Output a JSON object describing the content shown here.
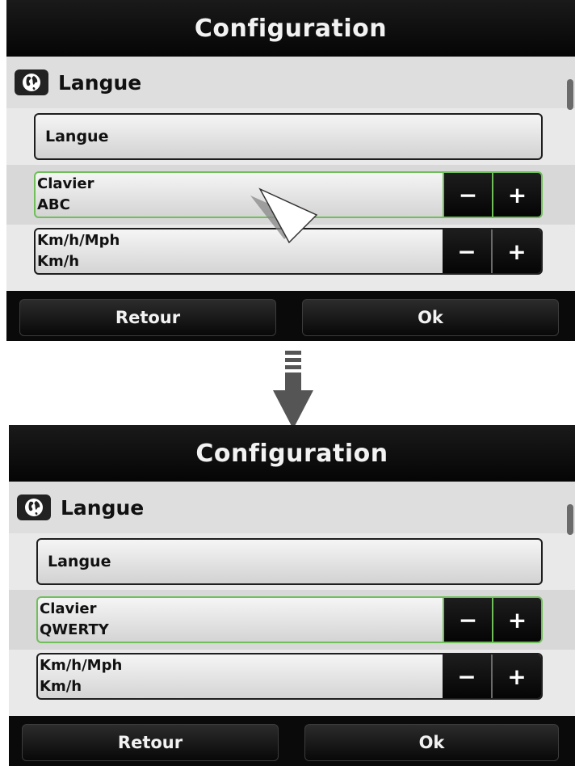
{
  "top": {
    "title": "Configuration",
    "section_title": "Langue",
    "language_button": "Langue",
    "keyboard": {
      "label": "Clavier",
      "value": "ABC"
    },
    "units": {
      "label": "Km/h/Mph",
      "value": "Km/h"
    },
    "minus": "−",
    "plus": "+",
    "back": "Retour",
    "ok": "Ok"
  },
  "bottom": {
    "title": "Configuration",
    "section_title": "Langue",
    "language_button": "Langue",
    "keyboard": {
      "label": "Clavier",
      "value": "QWERTY"
    },
    "units": {
      "label": "Km/h/Mph",
      "value": "Km/h"
    },
    "minus": "−",
    "plus": "+",
    "back": "Retour",
    "ok": "Ok"
  },
  "icons": {
    "section": "globe-icon",
    "transition": "down-arrow-icon",
    "cursor": "pointer-arrow-icon"
  },
  "colors": {
    "active_border": "#6fbf5a",
    "bar_background": "#0a0a0a",
    "content_background": "#e9e9e9"
  }
}
